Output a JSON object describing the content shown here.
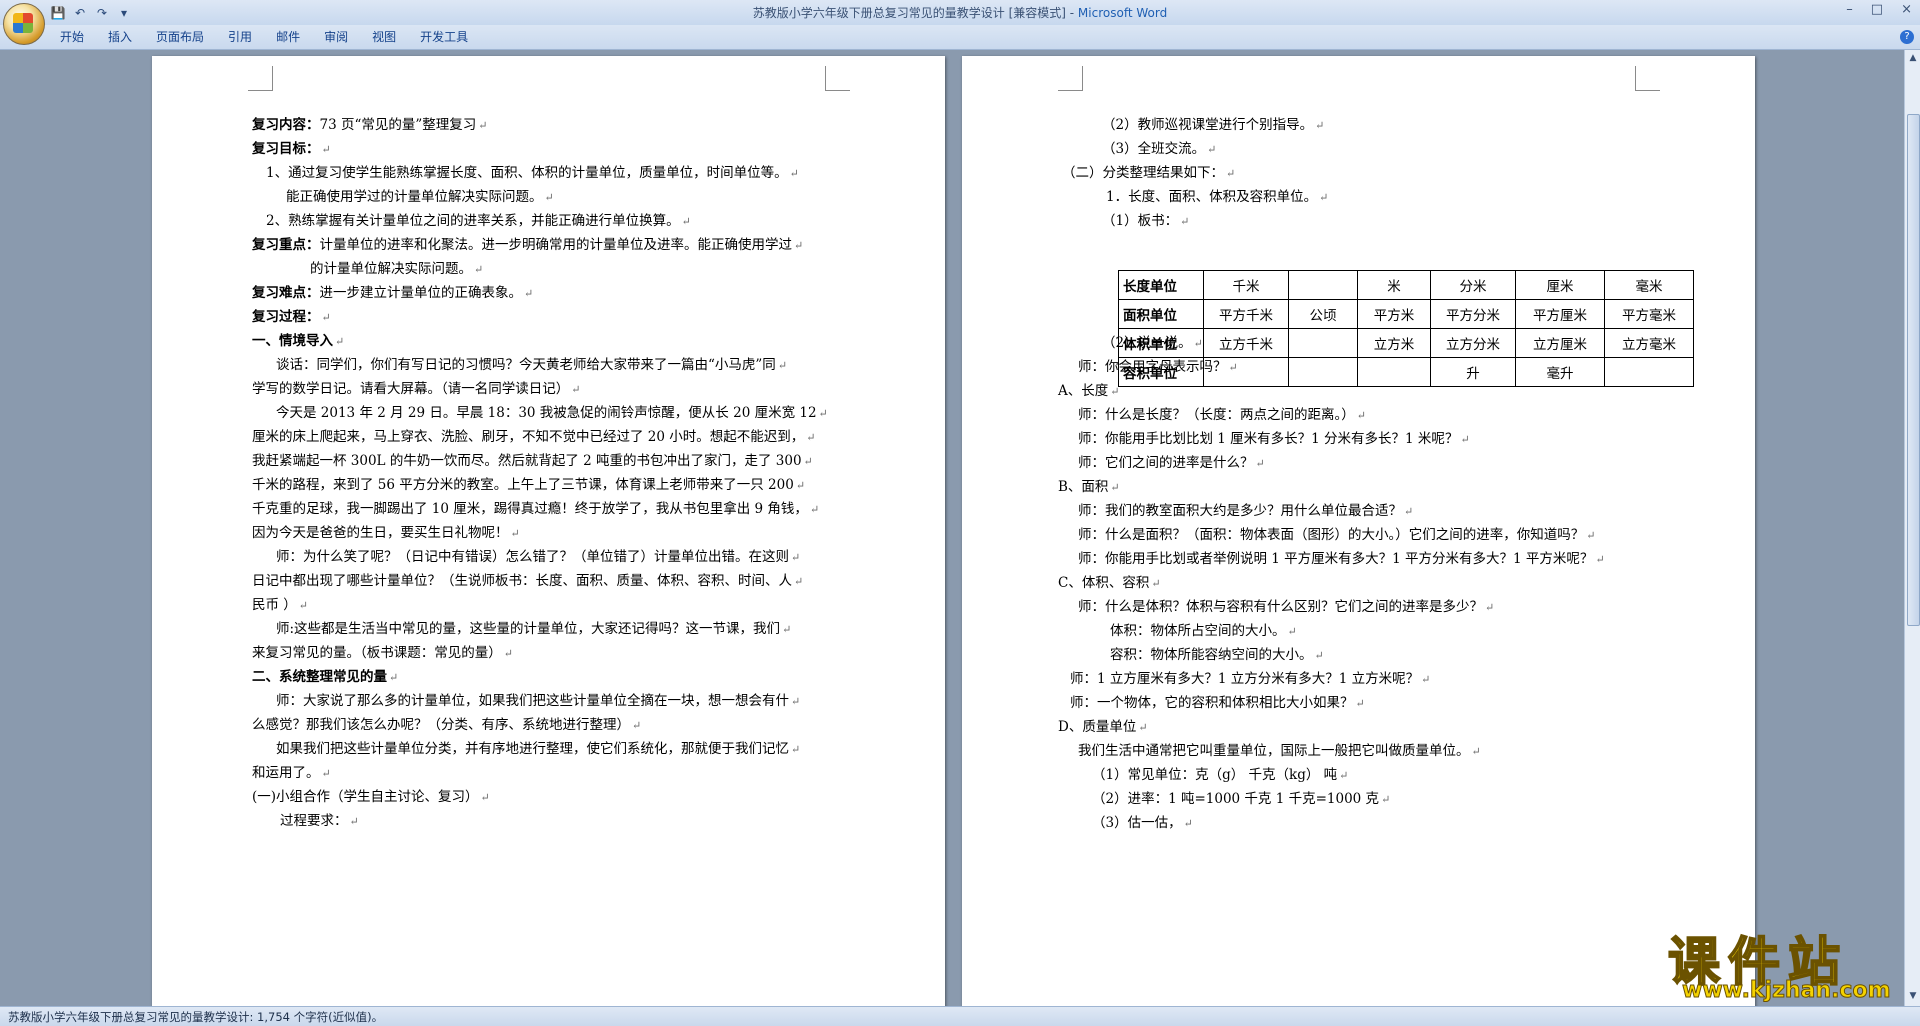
{
  "window": {
    "title": "苏教版小学六年级下册总复习常见的量教学设计 [兼容模式] - ",
    "app": "Microsoft Word"
  },
  "qat": {
    "save": "💾",
    "undo": "↶",
    "redo": "↷",
    "more": "▾"
  },
  "controls": {
    "min": "–",
    "max": "□",
    "close": "×"
  },
  "tabs": [
    "开始",
    "插入",
    "页面布局",
    "引用",
    "邮件",
    "审阅",
    "视图",
    "开发工具"
  ],
  "help": "?",
  "left_page": [
    {
      "b": "复习内容：",
      "t": "73 页“常见的量”整理复习"
    },
    {
      "b": "复习目标：",
      "t": ""
    },
    {
      "b": "",
      "t": "1、通过复习使学生能熟练掌握长度、面积、体积的计量单位，质量单位，时间单位等。"
    },
    {
      "b": "",
      "t": "能正确使用学过的计量单位解决实际问题。"
    },
    {
      "b": "",
      "t": "2、熟练掌握有关计量单位之间的进率关系，并能正确进行单位换算。"
    },
    {
      "b": "复习重点：",
      "t": "计量单位的进率和化聚法。进一步明确常用的计量单位及进率。能正确使用学过"
    },
    {
      "b": "",
      "t": "的计量单位解决实际问题。"
    },
    {
      "b": "复习难点：",
      "t": "进一步建立计量单位的正确表象。"
    },
    {
      "b": "复习过程：",
      "t": ""
    },
    {
      "b": "一、情境导入",
      "t": ""
    },
    {
      "b": "",
      "t": "谈话：同学们，你们有写日记的习惯吗？今天黄老师给大家带来了一篇由“小马虎”同"
    },
    {
      "b": "",
      "t": "学写的数学日记。请看大屏幕。（请一名同学读日记）"
    },
    {
      "b": "",
      "t": "今天是 2013 年 2 月 29 日。早晨 18：30 我被急促的闹铃声惊醒，便从长 20 厘米宽 12"
    },
    {
      "b": "",
      "t": "厘米的床上爬起来，马上穿衣、洗脸、刷牙，不知不觉中已经过了 20 小时。想起不能迟到，"
    },
    {
      "b": "",
      "t": "我赶紧端起一杯 300L 的牛奶一饮而尽。然后就背起了 2 吨重的书包冲出了家门，走了 300"
    },
    {
      "b": "",
      "t": "千米的路程，来到了 56 平方分米的教室。上午上了三节课，体育课上老师带来了一只 200"
    },
    {
      "b": "",
      "t": "千克重的足球，我一脚踢出了 10 厘米，踢得真过瘾！终于放学了，我从书包里拿出 9 角钱，"
    },
    {
      "b": "",
      "t": "因为今天是爸爸的生日，要买生日礼物呢！"
    },
    {
      "b": "",
      "t": "师：为什么笑了呢？（日记中有错误）怎么错了？（单位错了）计量单位出错。在这则"
    },
    {
      "b": "",
      "t": "日记中都出现了哪些计量单位？（生说师板书：长度、面积、质量、体积、容积、时间、人"
    },
    {
      "b": "",
      "t": "民币 ）"
    },
    {
      "b": "",
      "t": "师:这些都是生活当中常见的量，这些量的计量单位，大家还记得吗？这一节课，我们"
    },
    {
      "b": "",
      "t": "来复习常见的量。（板书课题：常见的量）"
    },
    {
      "b": "二、系统整理常见的量",
      "t": ""
    },
    {
      "b": "",
      "t": "师：大家说了那么多的计量单位，如果我们把这些计量单位全摘在一块，想一想会有什"
    },
    {
      "b": "",
      "t": "么感觉？那我们该怎么办呢？（分类、有序、系统地进行整理）"
    },
    {
      "b": "",
      "t": "如果我们把这些计量单位分类，并有序地进行整理，使它们系统化，那就便于我们记忆"
    },
    {
      "b": "",
      "t": "和运用了。"
    },
    {
      "b": "",
      "t": "(一)小组合作（学生自主讨论、复习）"
    },
    {
      "b": "",
      "t": "过程要求："
    }
  ],
  "right_page": [
    {
      "t": "（2）教师巡视课堂进行个别指导。"
    },
    {
      "t": "（3）全班交流。"
    },
    {
      "t": "（二）分类整理结果如下："
    },
    {
      "t": "1．长度、面积、体积及容积单位。"
    },
    {
      "t": "（1）板书："
    },
    {
      "t": "（2）说一说。"
    },
    {
      "t": "师：你会用字母表示吗？"
    },
    {
      "t": "A、长度"
    },
    {
      "t": "师：什么是长度？（长度：两点之间的距离。）"
    },
    {
      "t": "师：你能用手比划比划 1 厘米有多长？1 分米有多长？1 米呢？"
    },
    {
      "t": "师：它们之间的进率是什么？"
    },
    {
      "t": "B、面积"
    },
    {
      "t": "师：我们的教室面积大约是多少？用什么单位最合适？"
    },
    {
      "t": "师：什么是面积？（面积：物体表面（图形）的大小。）它们之间的进率，你知道吗？"
    },
    {
      "t": "师：你能用手比划或者举例说明 1 平方厘米有多大？1 平方分米有多大？1 平方米呢？"
    },
    {
      "t": "C、体积、容积"
    },
    {
      "t": "师：什么是体积？体积与容积有什么区别？它们之间的进率是多少？"
    },
    {
      "t": "体积：物体所占空间的大小。"
    },
    {
      "t": "容积：物体所能容纳空间的大小。"
    },
    {
      "t": "师：1 立方厘米有多大？1 立方分米有多大？1 立方米呢？"
    },
    {
      "t": "师：一个物体，它的容积和体积相比大小如果？"
    },
    {
      "t": "D、质量单位"
    },
    {
      "t": "我们生活中通常把它叫重量单位，国际上一般把它叫做质量单位。"
    },
    {
      "t": "（1）常见单位：克（g）    千克（kg）     吨"
    },
    {
      "t": "（2）进率：1 吨=1000 千克              1 千克=1000 克"
    },
    {
      "t": "（3）估一估，"
    }
  ],
  "table": [
    [
      "长度单位",
      "千米",
      "",
      "米",
      "分米",
      "厘米",
      "毫米"
    ],
    [
      "面积单位",
      "平方千米",
      "公顷",
      "平方米",
      "平方分米",
      "平方厘米",
      "平方毫米"
    ],
    [
      "体积单位",
      "立方千米",
      "",
      "立方米",
      "立方分米",
      "立方厘米",
      "立方毫米"
    ],
    [
      "容积单位",
      "",
      "",
      "",
      "升",
      "毫升",
      ""
    ]
  ],
  "status": "苏教版小学六年级下册总复习常见的量教学设计: 1,754 个字符(近似值)。",
  "watermark": {
    "title": "课件站",
    "url": "www.kjzhan.com"
  }
}
